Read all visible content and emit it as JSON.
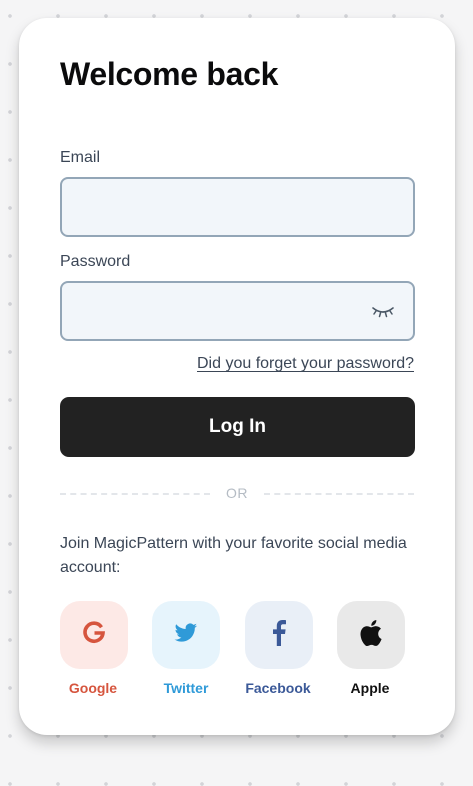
{
  "login": {
    "title": "Welcome back",
    "email_label": "Email",
    "email_value": "",
    "password_label": "Password",
    "password_value": "",
    "forgot_link": "Did you forget your password?",
    "login_button": "Log In",
    "divider_text": "OR",
    "social_prompt": "Join MagicPattern with your favorite social media account:"
  },
  "social": [
    {
      "label": "Google",
      "icon": "google-icon",
      "color": "#d6553e",
      "bg": "#fde9e6"
    },
    {
      "label": "Twitter",
      "icon": "twitter-icon",
      "color": "#2f9ad8",
      "bg": "#e6f4fc"
    },
    {
      "label": "Facebook",
      "icon": "facebook-icon",
      "color": "#3b5998",
      "bg": "#e9eff7"
    },
    {
      "label": "Apple",
      "icon": "apple-icon",
      "color": "#111111",
      "bg": "#e9e9e9"
    }
  ],
  "colors": {
    "button_bg": "#222222",
    "field_bg": "#f2f6fa",
    "field_border": "#93a6b7"
  }
}
